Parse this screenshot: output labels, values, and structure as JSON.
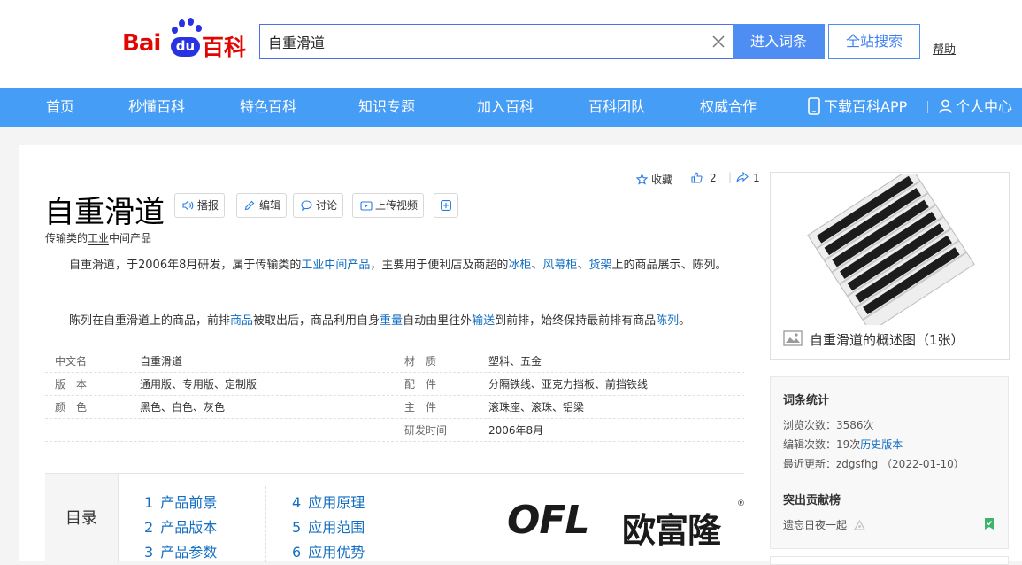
{
  "header": {
    "logo": {
      "bai": "Bai",
      "du": "du",
      "baike": "百科"
    },
    "search": {
      "value": "自重滑道",
      "placeholder": ""
    },
    "enter_button": "进入词条",
    "site_search_button": "全站搜索",
    "help_link": "帮助"
  },
  "nav": {
    "items": [
      "首页",
      "秒懂百科",
      "特色百科",
      "知识专题",
      "加入百科",
      "百科团队",
      "权威合作"
    ],
    "download_app": "下载百科APP",
    "personal_center": "个人中心"
  },
  "entry": {
    "title": "自重滑道",
    "tools": [
      "播报",
      "编辑",
      "讨论",
      "上传视频"
    ],
    "actions": {
      "collect": "收藏",
      "like_count": "2",
      "share_count": "1"
    },
    "subtitle": {
      "prefix": "传输类的",
      "link": "工业",
      "suffix": "中间产品"
    },
    "para1": {
      "t1": "自重滑道，于2006年8月研发，属于传输类的",
      "l1": "工业中间产品",
      "t2": "，主要用于便利店及商超的",
      "l2": "冰柜",
      "t3": "、",
      "l3": "风幕柜",
      "t4": "、",
      "l4": "货架",
      "t5": "上的商品展示、陈列。"
    },
    "para2": {
      "t1": "陈列在自重滑道上的商品，前排",
      "l1": "商品",
      "t2": "被取出后，商品利用自身",
      "l2": "重量",
      "t3": "自动由里往外",
      "l3": "输送",
      "t4": "到前排，始终保持最前排有商品",
      "l4": "陈列",
      "t5": "。"
    },
    "basic_info": [
      {
        "k1": "中文名",
        "v1": "自重滑道",
        "k2": "材　质",
        "v2": "塑料、五金"
      },
      {
        "k1": "版　本",
        "v1": "通用版、专用版、定制版",
        "k2": "配　件",
        "v2": "分隔铁线、亚克力挡板、前挡铁线"
      },
      {
        "k1": "颜　色",
        "v1": "黑色、白色、灰色",
        "k2": "主　件",
        "v2": "滚珠座、滚珠、铝梁"
      },
      {
        "k1": "",
        "v1": "",
        "k2": "研发时间",
        "v2": "2006年8月"
      }
    ],
    "toc": {
      "heading": "目录",
      "items": [
        {
          "n": "1",
          "label": "产品前景"
        },
        {
          "n": "2",
          "label": "产品版本"
        },
        {
          "n": "3",
          "label": "产品参数"
        },
        {
          "n": "4",
          "label": "应用原理"
        },
        {
          "n": "5",
          "label": "应用范围"
        },
        {
          "n": "6",
          "label": "应用优势"
        }
      ]
    },
    "brand_logo": {
      "latin": "OFL",
      "cjk": "欧富隆",
      "mark": "®"
    }
  },
  "sidebar": {
    "album_caption": "自重滑道的概述图（1张）",
    "stats": {
      "heading": "词条统计",
      "views": "浏览次数：3586次",
      "edits_prefix": "编辑次数：19次",
      "history_link": "历史版本",
      "last_update": "最近更新：zdgsfhg （2022-01-10）"
    },
    "contributors": {
      "heading": "突出贡献榜",
      "top_user": "遗忘日夜一起"
    }
  },
  "colors": {
    "nav_bg": "#459df5",
    "link": "#136ec2",
    "button": "#4e8ef2",
    "logo_red": "#e10601",
    "logo_blue": "#2932e1"
  }
}
